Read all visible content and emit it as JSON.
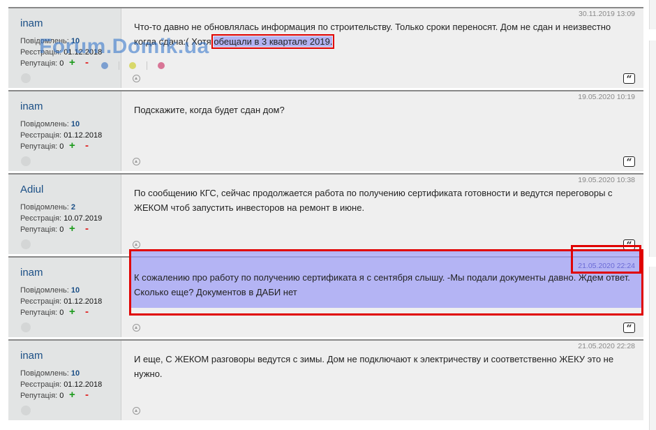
{
  "site": {
    "watermark": "Forum.Domik.ua"
  },
  "labels": {
    "posts_label": "Повідомлень:",
    "reg_label": "Реєстрація:",
    "rep_label": "Репутація:",
    "rep_plus": "+",
    "rep_minus": "-",
    "quote_icon": "quote-icon"
  },
  "posts": [
    {
      "user": "inam",
      "posts": "10",
      "registered": "01.12.2018",
      "reputation": "0",
      "date": "30.11.2019 13:09",
      "text_before": "Что-то давно не обновлялась информация по строительству. Только сроки переносят. Дом не сдан и неизвестно когда сдача:( Хотя ",
      "text_highlight": "обещали в 3 квартале 2019."
    },
    {
      "user": "inam",
      "posts": "10",
      "registered": "01.12.2018",
      "reputation": "0",
      "date": "19.05.2020 10:19",
      "text": "Подскажите, когда будет сдан дом?"
    },
    {
      "user": "Adiul",
      "posts": "2",
      "registered": "10.07.2019",
      "reputation": "0",
      "date": "19.05.2020 10:38",
      "text": "По сообщению КГС, сейчас продолжается работа по получению сертификата готовности и ведутся переговоры с ЖЕКОМ чтоб запустить инвесторов на ремонт в июне."
    },
    {
      "user": "inam",
      "posts": "10",
      "registered": "01.12.2018",
      "reputation": "0",
      "date": "21.05.2020 22:24",
      "text": "К сожалению про работу по получению сертификата я с сентября слышу. -Мы подали документы давно. Ждем ответ. Сколько еще? Документов в ДАБИ нет"
    },
    {
      "user": "inam",
      "posts": "10",
      "registered": "01.12.2018",
      "reputation": "0",
      "date": "21.05.2020 22:28",
      "text": "И еще, С ЖЕКОМ разговоры ведутся с зимы. Дом не подключают к электричеству и соответственно ЖЕКУ это не нужно."
    }
  ]
}
